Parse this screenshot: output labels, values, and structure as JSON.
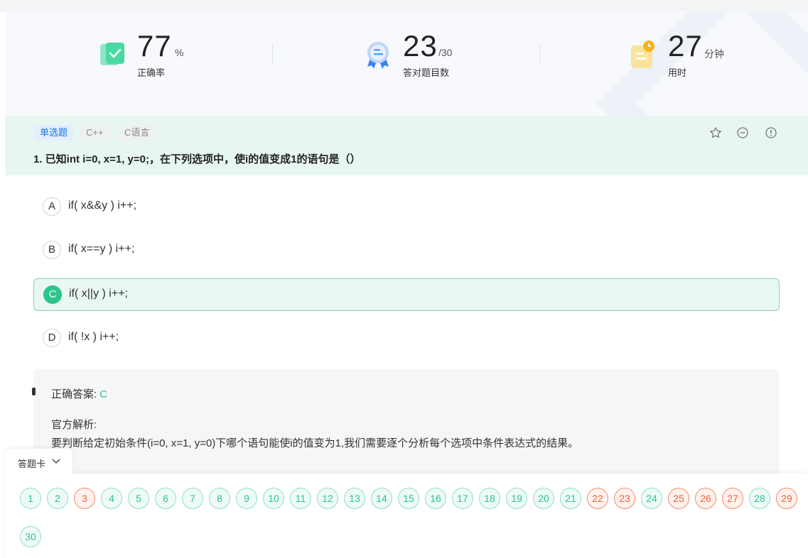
{
  "stats": {
    "accuracy": {
      "value": "77",
      "unit": "%",
      "label": "正确率"
    },
    "correct": {
      "value": "23",
      "unit": "/30",
      "label": "答对题目数"
    },
    "time": {
      "value": "27",
      "unit": "分钟",
      "label": "用时"
    }
  },
  "question": {
    "tags": [
      "单选题",
      "C++",
      "C语言"
    ],
    "title": "1. 已知int i=0, x=1, y=0;，在下列选项中，使i的值变成1的语句是（）",
    "options": [
      {
        "key": "A",
        "text": "if( x&&y ) i++;"
      },
      {
        "key": "B",
        "text": "if( x==y ) i++;"
      },
      {
        "key": "C",
        "text": "if( x||y ) i++;"
      },
      {
        "key": "D",
        "text": "if( !x ) i++;"
      }
    ],
    "selected": "C"
  },
  "explanation": {
    "answer_label": "正确答案:",
    "answer_value": "C",
    "analysis_label": "官方解析:",
    "analysis_text": "要判断给定初始条件(i=0, x=1, y=0)下哪个语句能使i的值变为1,我们需要逐个分析每个选项中条件表达式的结果。"
  },
  "answer_card": {
    "label": "答题卡",
    "numbers": [
      "1",
      "2",
      "3",
      "4",
      "5",
      "6",
      "7",
      "8",
      "9",
      "10",
      "11",
      "12",
      "13",
      "14",
      "15",
      "16",
      "17",
      "18",
      "19",
      "20",
      "21",
      "22",
      "23",
      "24",
      "25",
      "26",
      "27",
      "28",
      "29",
      "30"
    ],
    "wrong": [
      "3",
      "22",
      "23",
      "25",
      "26",
      "27",
      "29"
    ]
  },
  "colors": {
    "accent": "#2dc58c",
    "wrong": "#f0643d",
    "tag_blue": "#1a73e8"
  }
}
